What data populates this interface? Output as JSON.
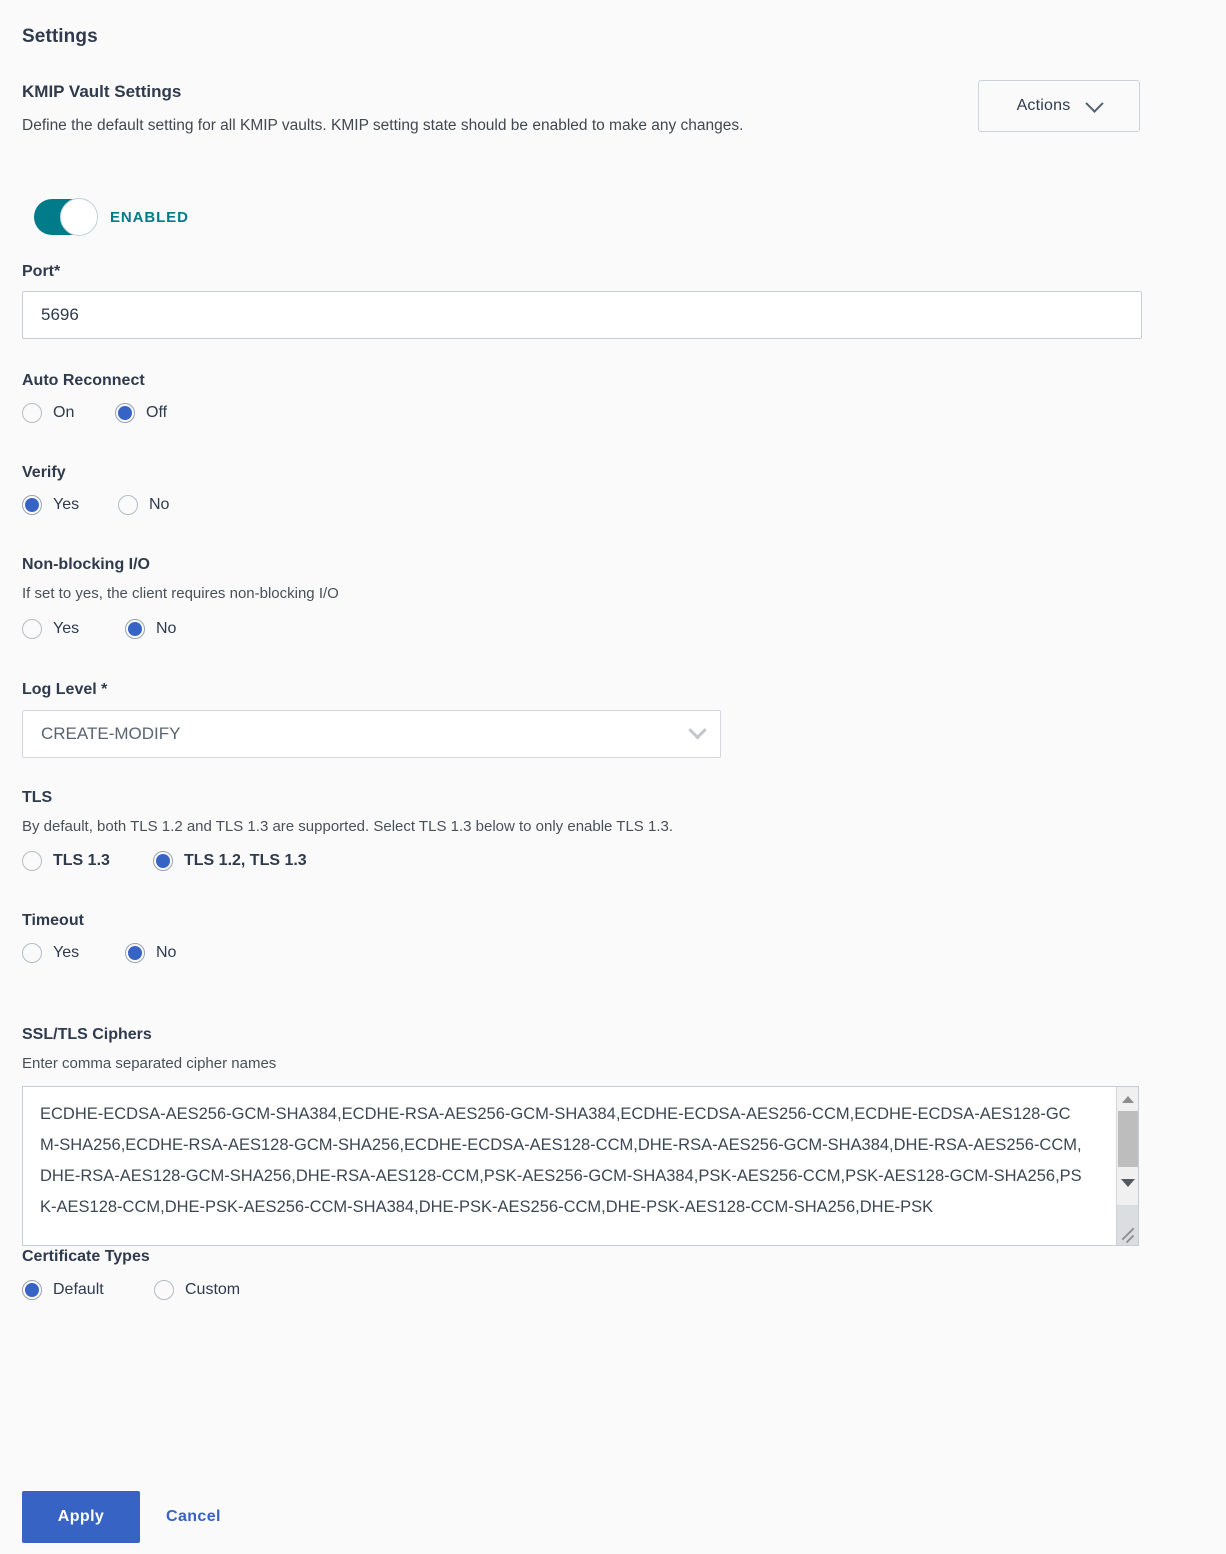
{
  "page": {
    "title": "Settings"
  },
  "section": {
    "heading": "KMIP Vault Settings",
    "description": "Define the default setting for all KMIP vaults. KMIP setting state should be enabled to make any changes."
  },
  "actions": {
    "label": "Actions",
    "caret": "chevron-down-icon"
  },
  "enable_toggle": {
    "label": "ENABLED",
    "state": "on",
    "color": "#007b8a"
  },
  "port": {
    "label": "Port",
    "required_marker": "*",
    "value": "5696"
  },
  "auto_reconnect": {
    "label": "Auto Reconnect",
    "options": [
      "On",
      "Off"
    ],
    "selected": "Off"
  },
  "verify": {
    "label": "Verify",
    "options": [
      "Yes",
      "No"
    ],
    "selected": "Yes"
  },
  "non_blocking_io": {
    "label": "Non-blocking I/O",
    "help": "If set to yes, the client requires non-blocking I/O",
    "options": [
      "Yes",
      "No"
    ],
    "selected": "No"
  },
  "log_level": {
    "label": "Log Level *",
    "value": "CREATE-MODIFY"
  },
  "tls": {
    "label": "TLS",
    "help": "By default, both TLS 1.2 and TLS 1.3 are supported. Select TLS 1.3 below to only enable TLS 1.3.",
    "options": [
      "TLS 1.3",
      "TLS 1.2, TLS 1.3"
    ],
    "selected": "TLS 1.2, TLS 1.3"
  },
  "timeout": {
    "label": "Timeout",
    "options": [
      "Yes",
      "No"
    ],
    "selected": "No"
  },
  "ciphers": {
    "label": "SSL/TLS Ciphers",
    "help": "Enter comma separated cipher names",
    "value": "ECDHE-ECDSA-AES256-GCM-SHA384,ECDHE-RSA-AES256-GCM-SHA384,ECDHE-ECDSA-AES256-CCM,ECDHE-ECDSA-AES128-GCM-SHA256,ECDHE-RSA-AES128-GCM-SHA256,ECDHE-ECDSA-AES128-CCM,DHE-RSA-AES256-GCM-SHA384,DHE-RSA-AES256-CCM,DHE-RSA-AES128-GCM-SHA256,DHE-RSA-AES128-CCM,PSK-AES256-GCM-SHA384,PSK-AES256-CCM,PSK-AES128-GCM-SHA256,PSK-AES128-CCM,DHE-PSK-AES256-CCM-SHA384,DHE-PSK-AES256-CCM,DHE-PSK-AES128-CCM-SHA256,DHE-PSK"
  },
  "certificate_types": {
    "label": "Certificate Types",
    "options": [
      "Default",
      "Custom"
    ],
    "selected": "Default"
  },
  "footer": {
    "apply_label": "Apply",
    "cancel_label": "Cancel",
    "primary_color": "#3763c4"
  }
}
